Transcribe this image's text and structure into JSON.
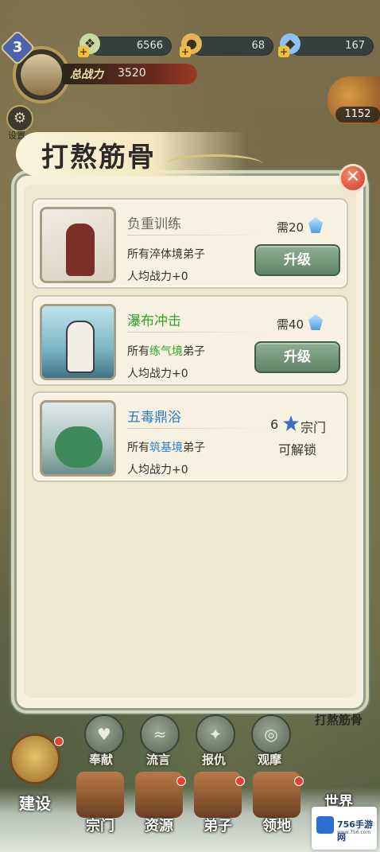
{
  "hud": {
    "level": "3",
    "power_label": "总战力",
    "power_value": "3520",
    "resources": [
      {
        "icon": "jade-icon",
        "value": "6566"
      },
      {
        "icon": "gold-ingot-icon",
        "value": "68"
      },
      {
        "icon": "crystal-icon",
        "value": "167"
      }
    ],
    "settings_label": "设置",
    "treasure_count": "1152"
  },
  "dialog": {
    "title": "打熬筋骨",
    "items": [
      {
        "name": "负重训练",
        "scope_prefix": "所有",
        "scope_realm": "淬体境",
        "scope_suffix": "弟子",
        "power": "人均战力+0",
        "cost": "需20",
        "button": "升级",
        "name_color": "locked"
      },
      {
        "name": "瀑布冲击",
        "scope_prefix": "所有",
        "scope_realm": "练气境",
        "scope_suffix": "弟子",
        "power": "人均战力+0",
        "cost": "需40",
        "button": "升级",
        "name_color": "#2fa52f"
      },
      {
        "name": "五毒鼎浴",
        "scope_prefix": "所有",
        "scope_realm": "筑基境",
        "scope_suffix": "弟子",
        "power": "人均战力+0",
        "unlock_count": "6",
        "unlock_unit": "宗门",
        "unlock_text": "可解锁",
        "name_color": "#2d7ec8"
      }
    ]
  },
  "side_label": "打熬筋骨",
  "skills": [
    {
      "label": "奉献"
    },
    {
      "label": "流言"
    },
    {
      "label": "报仇"
    },
    {
      "label": "观摩"
    }
  ],
  "nav": {
    "build": "建设",
    "items": [
      "宗门",
      "资源",
      "弟子",
      "领地",
      "世界"
    ]
  },
  "watermark": {
    "brand": "756手游网",
    "url": "www.756.com"
  },
  "colors": {
    "accent_green": "#2fa52f",
    "accent_blue": "#2d7ec8",
    "button_green": "#5f8464",
    "close_red": "#c63a2a"
  }
}
